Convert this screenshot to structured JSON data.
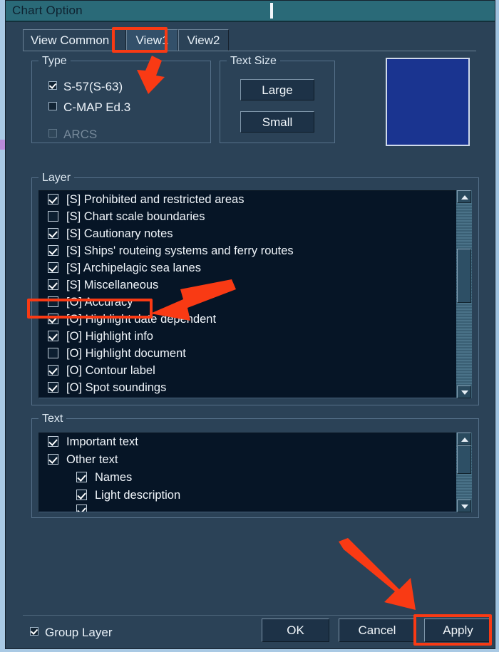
{
  "window": {
    "title": "Chart Option",
    "caret_icon": "text-caret"
  },
  "tabs": [
    {
      "label": "View Common",
      "active": false
    },
    {
      "label": "View1",
      "active": true
    },
    {
      "label": "View2",
      "active": false
    }
  ],
  "type_group": {
    "label": "Type",
    "options": [
      {
        "label": "S-57(S-63)",
        "checked": true,
        "enabled": true
      },
      {
        "label": "C-MAP Ed.3",
        "checked": false,
        "enabled": true
      },
      {
        "label": "ARCS",
        "checked": false,
        "enabled": false
      }
    ]
  },
  "text_size_group": {
    "label": "Text Size",
    "buttons": [
      {
        "label": "Large"
      },
      {
        "label": "Small"
      }
    ]
  },
  "color_swatch": {
    "name": "chart-color-preview",
    "color": "#1a3490"
  },
  "layer_group": {
    "label": "Layer",
    "items": [
      {
        "label": "[S] Prohibited and restricted areas",
        "checked": true
      },
      {
        "label": "[S] Chart scale boundaries",
        "checked": false
      },
      {
        "label": "[S] Cautionary notes",
        "checked": true
      },
      {
        "label": "[S] Ships' routeing systems and ferry routes",
        "checked": true
      },
      {
        "label": "[S] Archipelagic sea lanes",
        "checked": true
      },
      {
        "label": "[S] Miscellaneous",
        "checked": true
      },
      {
        "label": "[O] Accuracy",
        "checked": false
      },
      {
        "label": "[O] Highlight date dependent",
        "checked": true
      },
      {
        "label": "[O] Highlight info",
        "checked": true
      },
      {
        "label": "[O] Highlight document",
        "checked": false
      },
      {
        "label": "[O] Contour label",
        "checked": true
      },
      {
        "label": "[O] Spot soundings",
        "checked": true
      }
    ]
  },
  "text_group": {
    "label": "Text",
    "items": [
      {
        "label": "Important text",
        "checked": true,
        "indent": 0
      },
      {
        "label": "Other text",
        "checked": true,
        "indent": 0
      },
      {
        "label": "Names",
        "checked": true,
        "indent": 1
      },
      {
        "label": "Light description",
        "checked": true,
        "indent": 1
      }
    ]
  },
  "footer": {
    "group_layer": {
      "label": "Group Layer",
      "checked": true
    },
    "ok_label": "OK",
    "cancel_label": "Cancel",
    "apply_label": "Apply"
  },
  "annotations": {
    "color": "#f93a14",
    "highlights": [
      "View1 tab",
      "[O] Accuracy row",
      "Apply button"
    ],
    "arrows": 3
  },
  "scrollbars": {
    "layer": {
      "up_icon": "triangle-up-icon",
      "down_icon": "triangle-down-icon"
    },
    "text": {
      "up_icon": "triangle-up-icon",
      "down_icon": "triangle-down-icon"
    }
  }
}
